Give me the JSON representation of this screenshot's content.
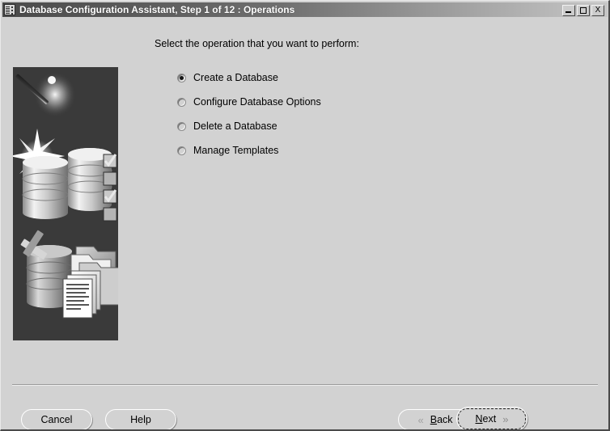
{
  "window": {
    "title": "Database Configuration Assistant, Step 1 of 12 : Operations",
    "icon": "database-icon",
    "controls": {
      "minimize": "minimize-button",
      "maximize": "maximize-button",
      "close_label": "X"
    }
  },
  "main": {
    "prompt": "Select the operation that you want to perform:",
    "options": [
      {
        "label": "Create a Database",
        "selected": true
      },
      {
        "label": "Configure Database Options",
        "selected": false
      },
      {
        "label": "Delete a Database",
        "selected": false
      },
      {
        "label": "Manage Templates",
        "selected": false
      }
    ]
  },
  "illustration": {
    "alt": "wizard wand with sparkle, database cylinders with checkboxes, deleted database with X, and template folders with documents",
    "background_color": "#3a3a3a"
  },
  "buttons": {
    "cancel": "Cancel",
    "help": "Help",
    "back": {
      "label_before": "",
      "accel": "B",
      "label_after": "ack",
      "chevron": "«",
      "disabled": true
    },
    "next": {
      "label_before": "",
      "accel": "N",
      "label_after": "ext",
      "chevron": "»",
      "focused": true
    }
  },
  "colors": {
    "window_bg": "#d2d2d2",
    "titlebar_start": "#4a4a4a",
    "titlebar_end": "#c6c6c6",
    "title_text": "#ffffff"
  }
}
